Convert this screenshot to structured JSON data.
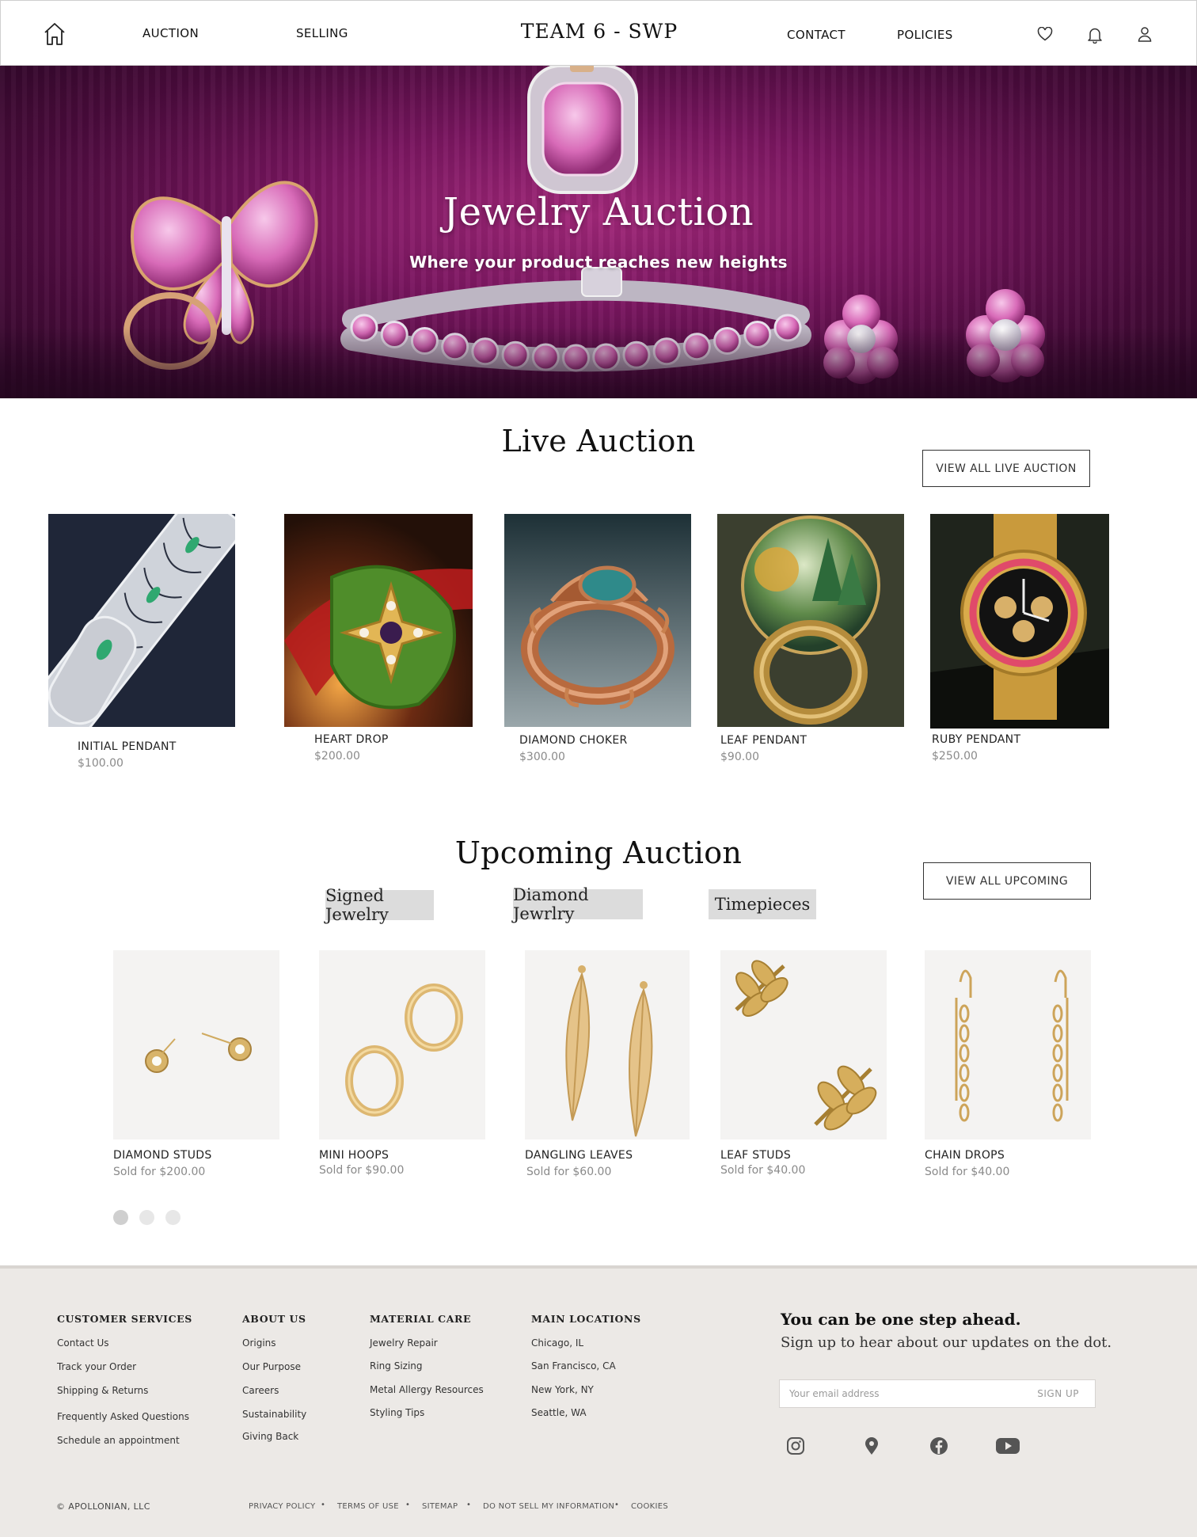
{
  "header": {
    "nav_left": [
      "AUCTION",
      "SELLING"
    ],
    "brand": "TEAM 6 - SWP",
    "nav_right": [
      "CONTACT",
      "POLICIES"
    ],
    "icons": [
      "home-icon",
      "heart-icon",
      "bell-icon",
      "user-icon"
    ]
  },
  "hero": {
    "title": "Jewelry Auction",
    "subtitle": "Where your product reaches new heights"
  },
  "live": {
    "title": "Live Auction",
    "view_all": "VIEW ALL LIVE AUCTION",
    "items": [
      {
        "name": "INITIAL PENDANT",
        "price": "$100.00"
      },
      {
        "name": "HEART DROP",
        "price": "$200.00"
      },
      {
        "name": "DIAMOND CHOKER",
        "price": "$300.00"
      },
      {
        "name": "LEAF PENDANT",
        "price": "$90.00"
      },
      {
        "name": "RUBY PENDANT",
        "price": "$250.00"
      }
    ]
  },
  "upcoming": {
    "title": "Upcoming Auction",
    "view_all": "VIEW ALL UPCOMING",
    "categories": [
      "Signed Jewelry",
      "Diamond Jewrlry",
      "Timepieces"
    ],
    "items": [
      {
        "name": "DIAMOND STUDS",
        "price": "Sold for $200.00"
      },
      {
        "name": "MINI HOOPS",
        "price": "Sold for $90.00"
      },
      {
        "name": "DANGLING LEAVES",
        "price": "Sold for $60.00"
      },
      {
        "name": "LEAF STUDS",
        "price": "Sold for $40.00"
      },
      {
        "name": "CHAIN DROPS",
        "price": "Sold for $40.00"
      }
    ],
    "pagination": {
      "pages": 3,
      "active": 1
    }
  },
  "footer": {
    "columns": [
      {
        "heading": "CUSTOMER SERVICES",
        "links": [
          "Contact Us",
          "Track your Order",
          "Shipping & Returns",
          "Frequently Asked Questions",
          "Schedule an appointment"
        ]
      },
      {
        "heading": "ABOUT US",
        "links": [
          "Origins",
          "Our Purpose",
          "Careers",
          "Sustainability",
          "Giving Back"
        ]
      },
      {
        "heading": "MATERIAL CARE",
        "links": [
          "Jewelry Repair",
          "Ring Sizing",
          "Metal Allergy Resources",
          "Styling Tips"
        ]
      },
      {
        "heading": "MAIN LOCATIONS",
        "links": [
          "Chicago, IL",
          "San Francisco, CA",
          "New York, NY",
          "Seattle, WA"
        ]
      }
    ],
    "newsletter": {
      "heading": "You can be one step ahead.",
      "subtext": "Sign up to hear about our updates on the dot.",
      "placeholder": "Your email address",
      "button": "SIGN UP"
    },
    "social": [
      "instagram-icon",
      "location-pin-icon",
      "facebook-icon",
      "youtube-icon"
    ],
    "copyright": "©  APOLLONIAN, LLC",
    "legal": [
      "PRIVACY POLICY",
      "TERMS OF USE",
      "SITEMAP",
      "DO NOT SELL MY INFORMATION",
      "COOKIES"
    ],
    "legal_separator": "•"
  },
  "colors": {
    "hero_bg": "#7a1660",
    "hero_accent": "#e58fd0",
    "footer_bg": "#ece9e6",
    "tab_bg": "#dcdcdc",
    "muted_text": "#8a8a8a",
    "gold": "#d4a85c"
  }
}
